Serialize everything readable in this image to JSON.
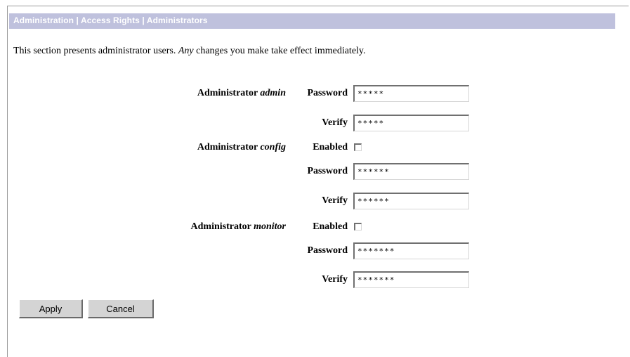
{
  "header": {
    "breadcrumb": "Administration | Access Rights | Administrators"
  },
  "intro": {
    "text_plain": "This section presents administrator users. ",
    "text_italic": "Any",
    "text_rest": " changes you make take effect immediately."
  },
  "admins": [
    {
      "prefix": "Administrator ",
      "role": "admin",
      "password_label": "Password",
      "password_value": "*****",
      "verify_label": "Verify",
      "verify_value": "*****"
    },
    {
      "prefix": "Administrator ",
      "role": "config",
      "enabled_label": "Enabled",
      "enabled": false,
      "password_label": "Password",
      "password_value": "******",
      "verify_label": "Verify",
      "verify_value": "******"
    },
    {
      "prefix": "Administrator ",
      "role": "monitor",
      "enabled_label": "Enabled",
      "enabled": false,
      "password_label": "Password",
      "password_value": "*******",
      "verify_label": "Verify",
      "verify_value": "*******"
    }
  ],
  "buttons": {
    "apply_label": "Apply",
    "cancel_label": "Cancel"
  }
}
